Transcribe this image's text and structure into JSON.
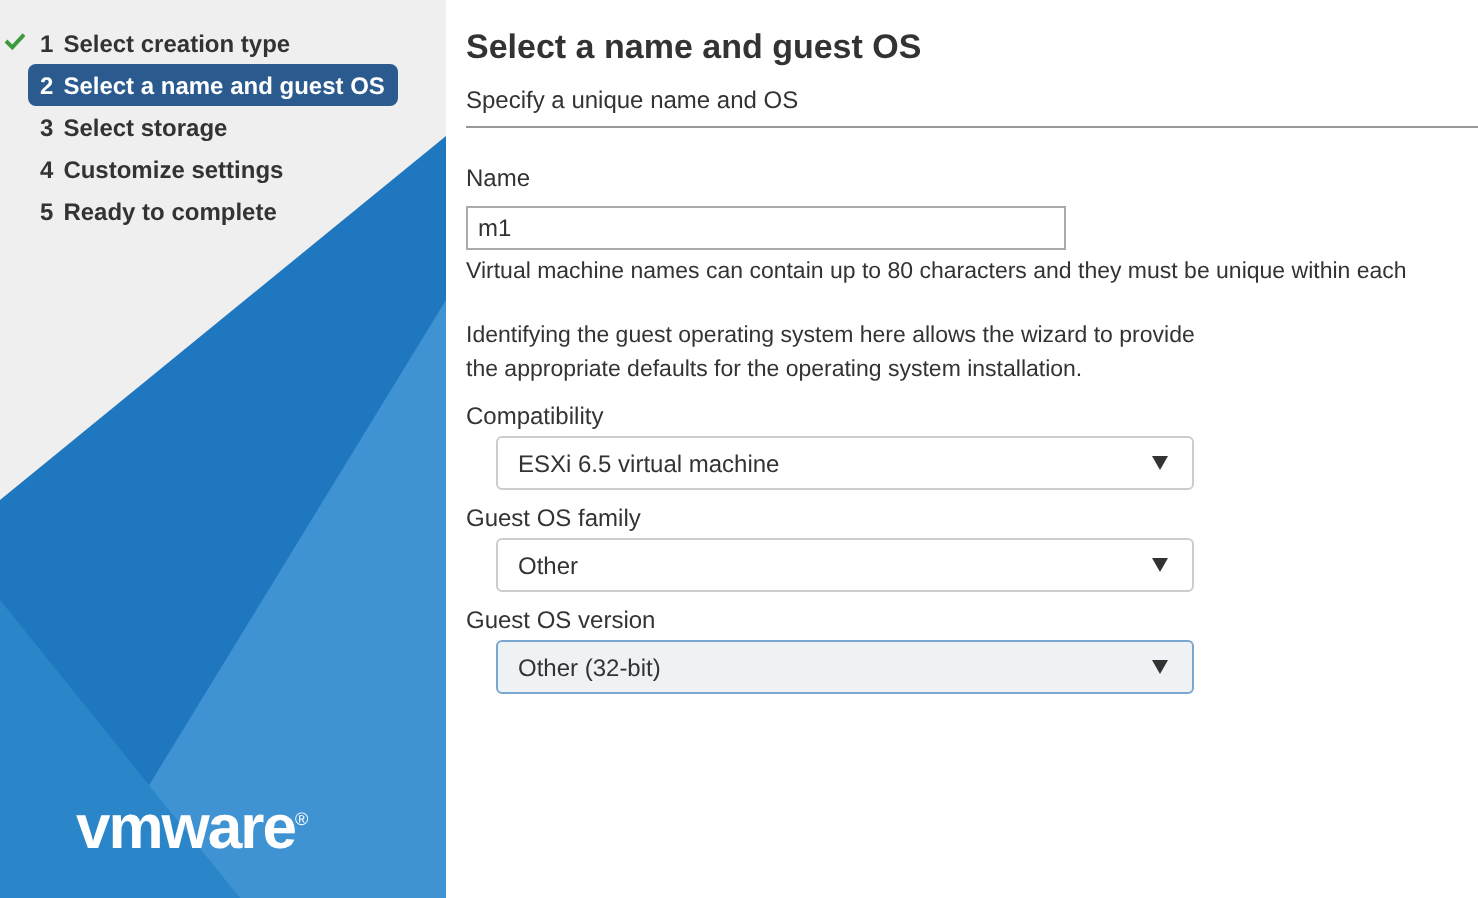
{
  "steps": [
    {
      "number": "1",
      "label": "Select creation type",
      "completed": true,
      "selected": false
    },
    {
      "number": "2",
      "label": "Select a name and guest OS",
      "completed": false,
      "selected": true
    },
    {
      "number": "3",
      "label": "Select storage",
      "completed": false,
      "selected": false
    },
    {
      "number": "4",
      "label": "Customize settings",
      "completed": false,
      "selected": false
    },
    {
      "number": "5",
      "label": "Ready to complete",
      "completed": false,
      "selected": false
    }
  ],
  "logo": {
    "text": "vmware",
    "mark": "®"
  },
  "page": {
    "title": "Select a name and guest OS",
    "subtitle": "Specify a unique name and OS"
  },
  "name_field": {
    "label": "Name",
    "value": "m1",
    "help": "Virtual machine names can contain up to 80 characters and they must be unique within each"
  },
  "description": [
    "Identifying the guest operating system here allows the wizard to provide",
    "the appropriate defaults for the operating system installation."
  ],
  "selects": [
    {
      "label": "Compatibility",
      "value": "ESXi 6.5 virtual machine",
      "focused": false
    },
    {
      "label": "Guest OS family",
      "value": "Other",
      "focused": false
    },
    {
      "label": "Guest OS version",
      "value": "Other (32-bit)",
      "focused": true
    }
  ]
}
